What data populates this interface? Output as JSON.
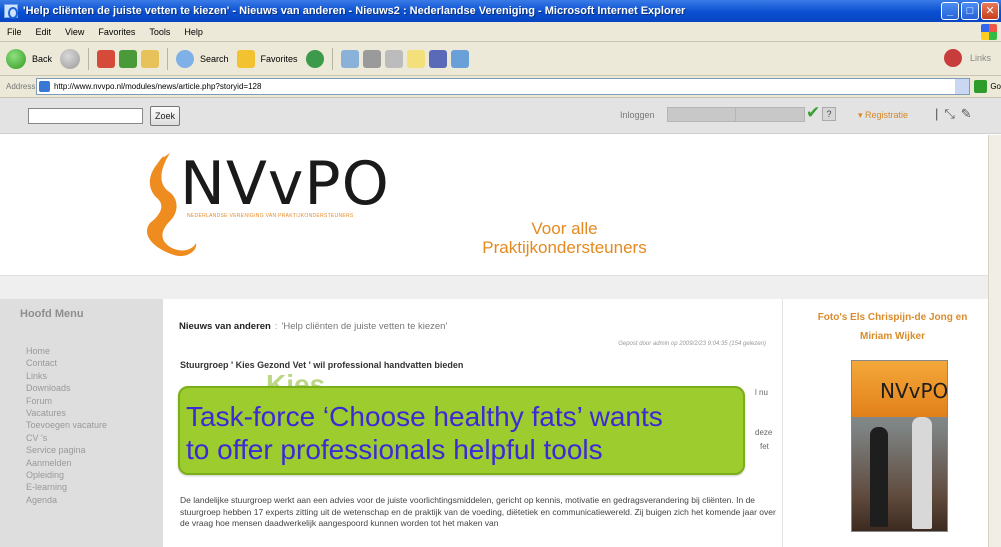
{
  "window": {
    "title": "'Help cliënten de juiste vetten te kiezen' - Nieuws van anderen - Nieuws2 : Nederlandse Vereniging - Microsoft Internet Explorer",
    "min": "_",
    "max": "□",
    "close": "✕"
  },
  "menubar": {
    "items": [
      "File",
      "Edit",
      "View",
      "Favorites",
      "Tools",
      "Help"
    ]
  },
  "toolbar": {
    "back": "Back",
    "search": "Search",
    "favorites": "Favorites",
    "links": "Links"
  },
  "address": {
    "label": "Address",
    "url": "http://www.nvvpo.nl/modules/news/article.php?storyid=128",
    "go": "Go"
  },
  "site_top": {
    "search_button": "Zoek",
    "login_label": "Inloggen",
    "login_help": "?",
    "register": "▾ Registratie",
    "separator": "|"
  },
  "header": {
    "logo": "NVvPO",
    "logo_sub": "NEDERLANDSE VERENIGING VAN PRAKTIJKONDERSTEUNERS",
    "tagline_line1": "Voor alle",
    "tagline_line2": "Praktijkondersteuners"
  },
  "left_menu": {
    "title": "Hoofd Menu",
    "items": [
      "Home",
      "Contact",
      "Links",
      "Downloads",
      "Forum",
      "Vacatures",
      "Toevoegen vacature",
      "CV 's",
      "Service pagina",
      "Aanmelden",
      "Opleiding",
      "E-learning",
      "Agenda"
    ]
  },
  "article": {
    "section": "Nieuws van anderen",
    "separator": ":",
    "title": "'Help cliënten de juiste vetten te kiezen'",
    "posted": "Gepost door admin op 2009/2/23 9:04:35 (154 gelezen)",
    "heading": "Stuurgroep ' Kies Gezond Vet ' wil professional handvatten bieden",
    "watermark": "Kies",
    "faint_right_1": "l nu",
    "faint_right_2": "deze",
    "faint_right_3": "fet",
    "body": "De landelijke stuurgroep werkt aan een advies voor de juiste voorlichtingsmiddelen, gericht op kennis, motivatie en gedragsverandering bij cliënten. In de stuurgroep hebben 17 experts zitting uit de wetenschap en de praktijk van de voeding, diëtetiek en communicatiewereld. Zij buigen zich het komende jaar over de vraag hoe mensen daadwerkelijk aangespoord kunnen worden tot het maken van"
  },
  "caption": {
    "line1": "Task-force ‘Choose healthy fats’ wants",
    "line2": "to offer professionals helpful tools"
  },
  "right_col": {
    "title_line1": "Foto's Els Chrispijn-de Jong en",
    "title_line2": "Miriam Wijker",
    "photo_logo": "NVvPO"
  }
}
